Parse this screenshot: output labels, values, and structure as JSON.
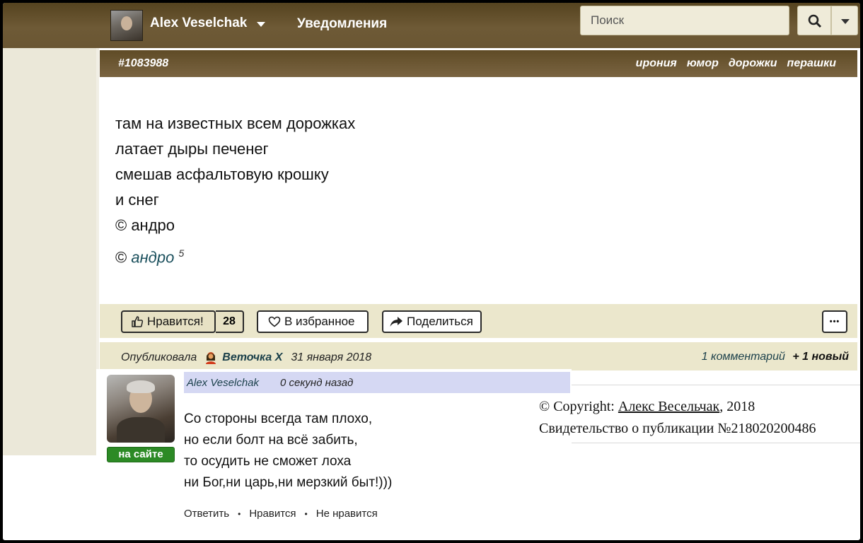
{
  "topbar": {
    "user_name": "Alex Veselchak",
    "notifications_label": "Уведомления",
    "search_placeholder": "Поиск"
  },
  "post": {
    "id": "#1083988",
    "tags": [
      "ирония",
      "юмор",
      "дорожки",
      "перашки"
    ],
    "lines": [
      "там на известных всем дорожках",
      "латает дыры печенег",
      "смешав асфальтовую крошку",
      "и снег",
      "© андро"
    ],
    "author_prefix": "©",
    "author_link": "андро",
    "author_rating": "5"
  },
  "actions": {
    "like_label": "Нравится!",
    "like_count": "28",
    "favorite_label": "В избранное",
    "share_label": "Поделиться",
    "more_label": "•••"
  },
  "meta": {
    "published_label": "Опубликовала",
    "publisher": "Веточка Х",
    "date": "31 января 2018",
    "comments_label": "1 комментарий",
    "new_label": "+ 1 новый"
  },
  "comment": {
    "user": "Alex Veselchak",
    "time": "0 секунд назад",
    "online_label": "на сайте",
    "lines": [
      "Со стороны всегда там плохо,",
      "но если болт на всё забить,",
      "то осудить не сможет лоха",
      "ни Бог,ни царь,ни мерзкий быт!)))"
    ],
    "reply_label": "Ответить",
    "like_label": "Нравится",
    "dislike_label": "Не нравится",
    "separator": "•"
  },
  "copyright": {
    "prefix": "© Copyright:",
    "author": "Алекс Весельчак",
    "year": ", 2018",
    "certificate": "Свидетельство о публикации №218020200486"
  },
  "colors": {
    "topbar": "#6e5a36",
    "post_header": "#6a5531",
    "panel": "#ebe7cc",
    "online": "#2c8a25",
    "link": "#1a3f4a"
  }
}
